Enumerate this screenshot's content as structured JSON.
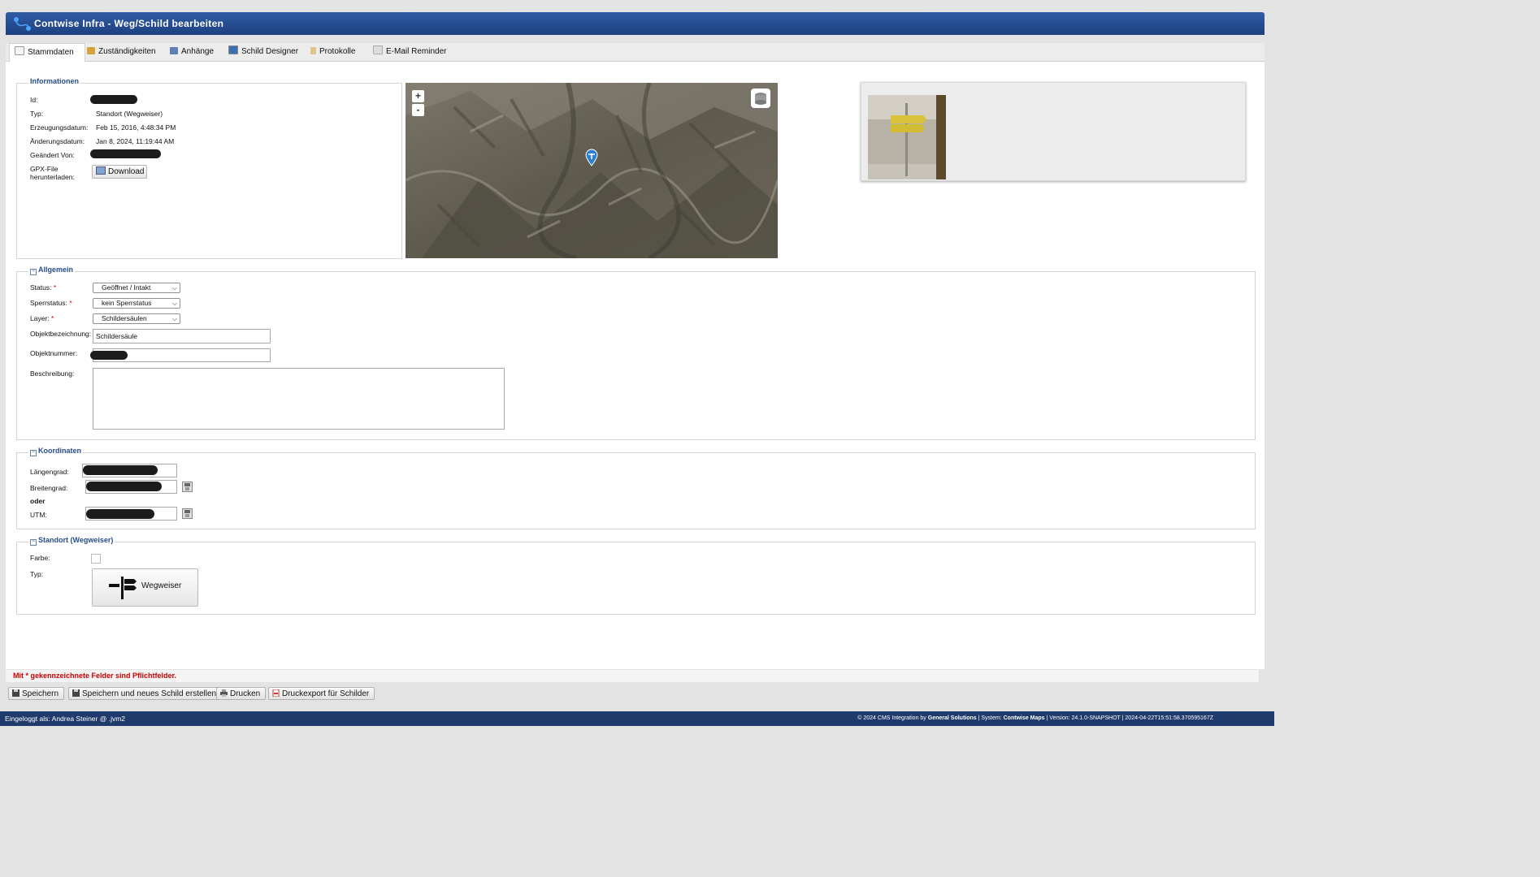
{
  "window": {
    "title": "Contwise Infra - Weg/Schild bearbeiten"
  },
  "tabs": [
    {
      "label": "Stammdaten",
      "icon": "document-icon",
      "active": true
    },
    {
      "label": "Zuständigkeiten",
      "icon": "users-icon"
    },
    {
      "label": "Anhänge",
      "icon": "images-icon"
    },
    {
      "label": "Schild Designer",
      "icon": "designer-icon"
    },
    {
      "label": "Protokolle",
      "icon": "clipboard-icon"
    },
    {
      "label": "E-Mail Reminder",
      "icon": "email-icon"
    }
  ],
  "info": {
    "legend": "Informationen",
    "id_label": "Id:",
    "typ_label": "Typ:",
    "typ_value": "Standort (Wegweiser)",
    "created_label": "Erzeugungsdatum:",
    "created_value": "Feb 15, 2016, 4:48:34 PM",
    "modified_label": "Änderungsdatum:",
    "modified_value": "Jan 8, 2024, 11:19:44 AM",
    "changed_by_label": "Geändert Von:",
    "gpx_label_1": "GPX-File",
    "gpx_label_2": "herunterladen:",
    "download_label": "Download"
  },
  "map": {
    "zoom_in": "+",
    "zoom_out": "-"
  },
  "allgemein": {
    "legend": "Allgemein",
    "status_label": "Status:",
    "status_value": "Geöffnet / Intakt",
    "sperr_label": "Sperrstatus:",
    "sperr_value": "kein Sperrstatus",
    "layer_label": "Layer:",
    "layer_value": "Schildersäulen",
    "objbez_label": "Objektbezeichnung:",
    "objbez_value": "Schildersäule",
    "objnr_label": "Objektnummer:",
    "beschreibung_label": "Beschreibung:",
    "beschreibung_value": "",
    "required_mark": "*"
  },
  "koordinaten": {
    "legend": "Koordinaten",
    "laengengrad_label": "Längengrad:",
    "breitengrad_label": "Breitengrad:",
    "oder_label": "oder",
    "utm_label": "UTM:"
  },
  "standort": {
    "legend": "Standort (Wegweiser)",
    "farbe_label": "Farbe:",
    "typ_label": "Typ:",
    "typ_button": "Wegweiser"
  },
  "required_note": "Mit * gekennzeichnete Felder sind Pflichtfelder.",
  "buttons": {
    "save": "Speichern",
    "save_new": "Speichern und neues Schild erstellen",
    "print": "Drucken",
    "print_export": "Druckexport für Schilder"
  },
  "statusbar": {
    "logged_in": "Eingeloggt als: Andrea Steiner @ .jvm2",
    "copyright_prefix": "© 2024 CMS Integration by",
    "company": "General Solutions",
    "system_prefix": " | System:",
    "system": "Contwise Maps",
    "version_text": " | Version: 24.1.0-SNAPSHOT | 2024-04-22T15:51:58.370595167Z"
  },
  "colors": {
    "header": "#2a5298",
    "legend": "#274d8c",
    "required": "#cc0000",
    "statusbar": "#1f3a6b"
  }
}
